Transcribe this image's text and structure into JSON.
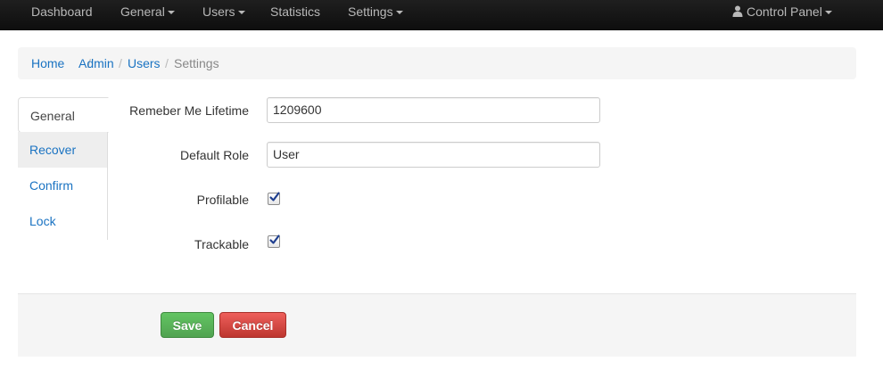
{
  "navbar": {
    "items": [
      {
        "label": "Dashboard",
        "dropdown": false
      },
      {
        "label": "General",
        "dropdown": true
      },
      {
        "label": "Users",
        "dropdown": true
      },
      {
        "label": "Statistics",
        "dropdown": false
      },
      {
        "label": "Settings",
        "dropdown": true
      }
    ],
    "user_menu": {
      "label": "Control Panel",
      "icon": "user-icon",
      "dropdown": true
    }
  },
  "breadcrumb": {
    "items": [
      "Home",
      "Admin",
      "Users"
    ],
    "separator": "/",
    "active": "Settings"
  },
  "tabs": {
    "items": [
      {
        "label": "General",
        "state": "active"
      },
      {
        "label": "Recover",
        "state": "hover"
      },
      {
        "label": "Confirm",
        "state": "link"
      },
      {
        "label": "Lock",
        "state": "link"
      }
    ]
  },
  "form": {
    "remember_me": {
      "label": "Remeber Me Lifetime",
      "value": "1209600"
    },
    "default_role": {
      "label": "Default Role",
      "value": "User"
    },
    "profilable": {
      "label": "Profilable",
      "checked": true
    },
    "trackable": {
      "label": "Trackable",
      "checked": true
    }
  },
  "actions": {
    "save_label": "Save",
    "cancel_label": "Cancel"
  },
  "colors": {
    "link": "#1a73c2",
    "navbar": "#1b1b1b",
    "success": "#5bb75b",
    "danger": "#da4f49"
  }
}
